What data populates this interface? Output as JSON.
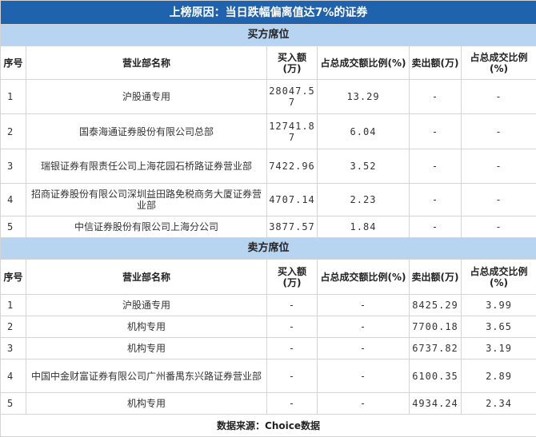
{
  "title": "上榜原因：当日跌幅偏离值达7%的证券",
  "buy_section": "买方席位",
  "sell_section": "卖方席位",
  "headers": [
    "序号",
    "营业部名称",
    "买入额(万)",
    "占总成交额比例(%)",
    "卖出额(万)",
    "占总成交比例(%)"
  ],
  "buy_rows": [
    {
      "idx": "1",
      "name": "沪股通专用",
      "buy": "28047.57",
      "buy_pct": "13.29",
      "sell": "-",
      "sell_pct": "-"
    },
    {
      "idx": "2",
      "name": "国泰海通证券股份有限公司总部",
      "buy": "12741.87",
      "buy_pct": "6.04",
      "sell": "-",
      "sell_pct": "-"
    },
    {
      "idx": "3",
      "name": "瑞银证券有限责任公司上海花园石桥路证券营业部",
      "buy": "7422.96",
      "buy_pct": "3.52",
      "sell": "-",
      "sell_pct": "-"
    },
    {
      "idx": "4",
      "name": "招商证券股份有限公司深圳益田路免税商务大厦证券营业部",
      "buy": "4707.14",
      "buy_pct": "2.23",
      "sell": "-",
      "sell_pct": "-"
    },
    {
      "idx": "5",
      "name": "中信证券股份有限公司上海分公司",
      "buy": "3877.57",
      "buy_pct": "1.84",
      "sell": "-",
      "sell_pct": "-"
    }
  ],
  "sell_rows": [
    {
      "idx": "1",
      "name": "沪股通专用",
      "buy": "-",
      "buy_pct": "-",
      "sell": "8425.29",
      "sell_pct": "3.99"
    },
    {
      "idx": "2",
      "name": "机构专用",
      "buy": "-",
      "buy_pct": "-",
      "sell": "7700.18",
      "sell_pct": "3.65"
    },
    {
      "idx": "3",
      "name": "机构专用",
      "buy": "-",
      "buy_pct": "-",
      "sell": "6737.82",
      "sell_pct": "3.19"
    },
    {
      "idx": "4",
      "name": "中国中金财富证券有限公司广州番禺东兴路证券营业部",
      "buy": "-",
      "buy_pct": "-",
      "sell": "6100.35",
      "sell_pct": "2.89"
    },
    {
      "idx": "5",
      "name": "机构专用",
      "buy": "-",
      "buy_pct": "-",
      "sell": "4934.24",
      "sell_pct": "2.34"
    }
  ],
  "footer": "数据来源：Choice数据"
}
